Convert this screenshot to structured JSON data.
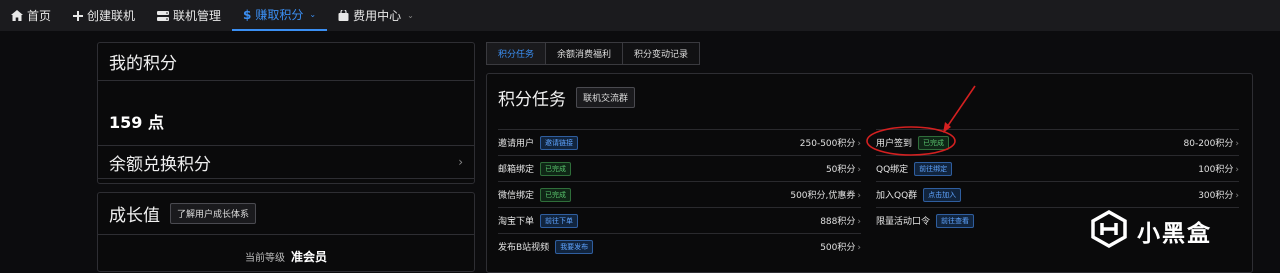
{
  "nav": {
    "items": [
      {
        "label": "首页",
        "icon": "home-icon"
      },
      {
        "label": "创建联机",
        "icon": "plus-icon"
      },
      {
        "label": "联机管理",
        "icon": "server-icon"
      },
      {
        "label": "赚取积分",
        "icon": "dollar-icon",
        "active": true
      },
      {
        "label": "费用中心",
        "icon": "bag-icon"
      }
    ],
    "accent": "#3b8ff3"
  },
  "my_points": {
    "title": "我的积分",
    "value": "159 点",
    "exchange_label": "余额兑换积分"
  },
  "growth": {
    "title": "成长值",
    "button": "了解用户成长体系",
    "level_label": "当前等级",
    "level_value": "准会员"
  },
  "tabs": [
    "积分任务",
    "余额消费福利",
    "积分变动记录"
  ],
  "tasks": {
    "title": "积分任务",
    "group_button": "联机交流群",
    "left": [
      {
        "name": "邀请用户",
        "tag": "邀请链接",
        "tag_type": "blue",
        "reward": "250-500积分"
      },
      {
        "name": "邮箱绑定",
        "tag": "已完成",
        "tag_type": "green",
        "reward": "50积分"
      },
      {
        "name": "微信绑定",
        "tag": "已完成",
        "tag_type": "green",
        "reward": "500积分,优惠券"
      },
      {
        "name": "淘宝下单",
        "tag": "前往下单",
        "tag_type": "blue",
        "reward": "888积分"
      },
      {
        "name": "发布B站视频",
        "tag": "我要发布",
        "tag_type": "blue",
        "reward": "500积分"
      }
    ],
    "right": [
      {
        "name": "用户签到",
        "tag": "已完成",
        "tag_type": "green",
        "reward": "80-200积分"
      },
      {
        "name": "QQ绑定",
        "tag": "前往绑定",
        "tag_type": "blue",
        "reward": "100积分"
      },
      {
        "name": "加入QQ群",
        "tag": "点击加入",
        "tag_type": "blue",
        "reward": "300积分"
      },
      {
        "name": "限量活动口令",
        "tag": "前往查看",
        "tag_type": "blue",
        "reward": ""
      }
    ],
    "chevron": "›"
  },
  "watermark": {
    "text": "小黑盒"
  },
  "colors": {
    "annotation": "#d42020",
    "tag_green": "#58c36c",
    "tag_blue": "#5fa4ff"
  }
}
